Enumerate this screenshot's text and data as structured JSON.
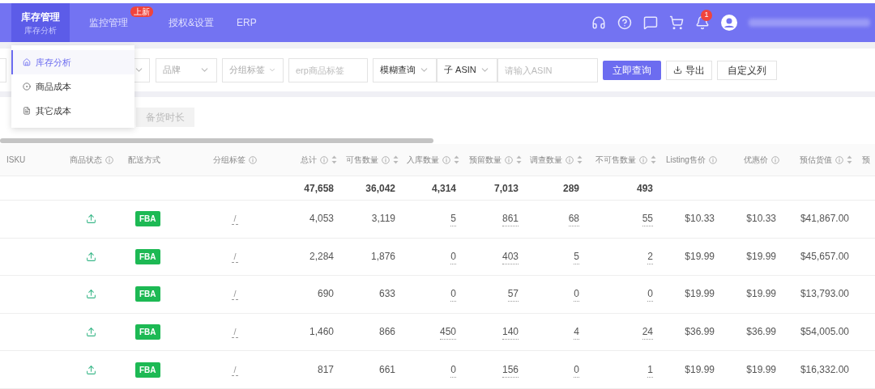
{
  "nav": {
    "tabs": [
      {
        "label": "库存管理",
        "sublabel": "库存分析",
        "selected": true
      },
      {
        "label": "监控管理",
        "badge": "上新",
        "selected": false
      },
      {
        "label": "授权&设置",
        "selected": false
      },
      {
        "label": "ERP",
        "selected": false
      }
    ],
    "notification_count": "1"
  },
  "menu": {
    "items": [
      {
        "label": "库存分析",
        "selected": true
      },
      {
        "label": "商品成本",
        "selected": false
      },
      {
        "label": "其它成本",
        "selected": false
      }
    ]
  },
  "filters": [
    {
      "kind": "select",
      "label": "品牌",
      "placeholder": true
    },
    {
      "kind": "select",
      "label": "分组标签",
      "placeholder": true
    },
    {
      "kind": "input",
      "placeholder": "erp商品标签"
    },
    {
      "kind": "select",
      "label": "模糊查询",
      "placeholder": false
    },
    {
      "kind": "select",
      "label": "子 ASIN",
      "placeholder": false
    },
    {
      "kind": "input",
      "placeholder": "请输入ASIN"
    },
    {
      "kind": "primary",
      "label": "立即查询"
    },
    {
      "kind": "export",
      "label": "导出"
    },
    {
      "kind": "plain",
      "label": "自定义列"
    }
  ],
  "secondary_button": "备货时长",
  "table": {
    "columns": [
      {
        "label": "ISKU",
        "help": false,
        "sortable": false
      },
      {
        "label": "商品状态",
        "help": true,
        "sortable": false
      },
      {
        "label": "配送方式",
        "help": false,
        "sortable": false
      },
      {
        "label": "分组标签",
        "help": true,
        "sortable": false
      },
      {
        "label": "总计",
        "help": true,
        "sortable": true,
        "linked": false
      },
      {
        "label": "可售数量",
        "help": true,
        "sortable": true,
        "linked": false
      },
      {
        "label": "入库数量",
        "help": true,
        "sortable": true,
        "linked": true
      },
      {
        "label": "预留数量",
        "help": true,
        "sortable": true,
        "linked": true
      },
      {
        "label": "调查数量",
        "help": true,
        "sortable": true,
        "linked": true
      },
      {
        "label": "不可售数量",
        "help": true,
        "sortable": true,
        "linked": true
      },
      {
        "label": "Listing售价",
        "help": true,
        "sortable": false,
        "linked": false
      },
      {
        "label": "优惠价",
        "help": true,
        "sortable": false,
        "linked": false
      },
      {
        "label": "预估货值",
        "help": true,
        "sortable": true,
        "linked": false
      },
      {
        "label": "预",
        "help": false,
        "sortable": false
      }
    ],
    "totals": [
      "47,658",
      "36,042",
      "4,314",
      "7,013",
      "289",
      "493"
    ],
    "rows": [
      {
        "delivery": "FBA",
        "group_tag": "/",
        "values": [
          "4,053",
          "3,119",
          "5",
          "861",
          "68",
          "55",
          "$10.33",
          "$10.33",
          "$41,867.00"
        ]
      },
      {
        "delivery": "FBA",
        "group_tag": "/",
        "values": [
          "2,284",
          "1,876",
          "0",
          "403",
          "5",
          "2",
          "$19.99",
          "$19.99",
          "$45,657.00"
        ]
      },
      {
        "delivery": "FBA",
        "group_tag": "/",
        "values": [
          "690",
          "633",
          "0",
          "57",
          "0",
          "0",
          "$19.99",
          "$19.99",
          "$13,793.00"
        ]
      },
      {
        "delivery": "FBA",
        "group_tag": "/",
        "values": [
          "1,460",
          "866",
          "450",
          "140",
          "4",
          "24",
          "$36.99",
          "$36.99",
          "$54,005.00"
        ]
      },
      {
        "delivery": "FBA",
        "group_tag": "/",
        "values": [
          "817",
          "661",
          "0",
          "156",
          "0",
          "1",
          "$19.99",
          "$19.99",
          "$16,332.00"
        ]
      }
    ]
  }
}
